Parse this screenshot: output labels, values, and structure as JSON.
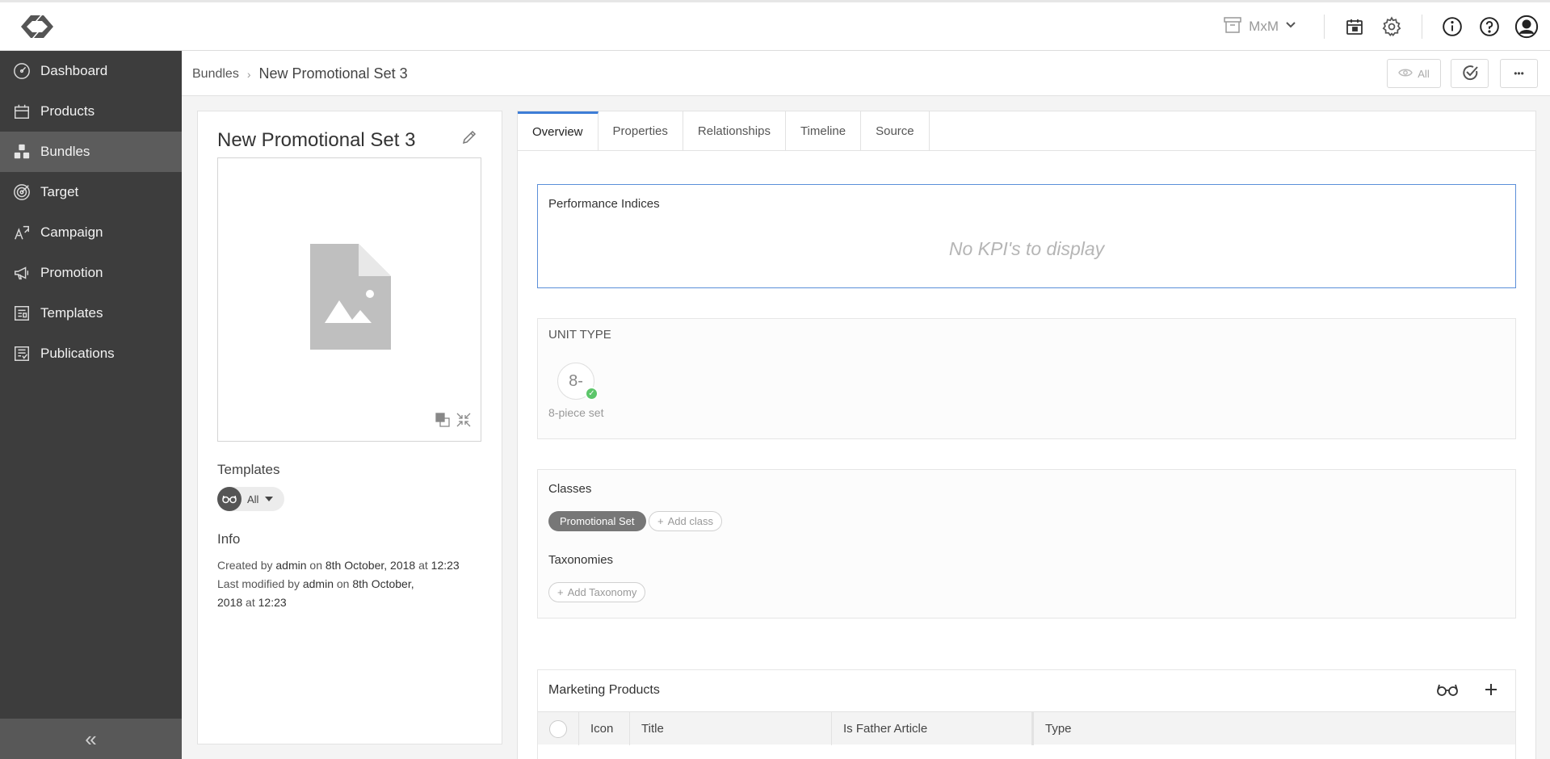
{
  "topbar": {
    "store_label": "MxM",
    "icons": [
      "logo-icon",
      "archive-icon",
      "chevron-down-icon",
      "calendar-box-icon",
      "gear-icon",
      "info-icon",
      "help-icon",
      "user-icon"
    ]
  },
  "sidebar": {
    "items": [
      {
        "label": "Dashboard",
        "icon": "dashboard-icon"
      },
      {
        "label": "Products",
        "icon": "products-icon"
      },
      {
        "label": "Bundles",
        "icon": "bundles-icon"
      },
      {
        "label": "Target",
        "icon": "target-icon"
      },
      {
        "label": "Campaign",
        "icon": "campaign-icon"
      },
      {
        "label": "Promotion",
        "icon": "megaphone-icon"
      },
      {
        "label": "Templates",
        "icon": "templates-icon"
      },
      {
        "label": "Publications",
        "icon": "publications-icon"
      }
    ],
    "active_index": 2,
    "collapse_label": "«"
  },
  "breadcrumb": {
    "parent": "Bundles",
    "separator": "›",
    "current": "New Promotional Set 3",
    "view_all_label": "All",
    "more_label": "•••"
  },
  "leftcard": {
    "title": "New Promotional Set 3",
    "templates_heading": "Templates",
    "templates_filter": "All",
    "info_heading": "Info",
    "created_prefix": "Created by",
    "created_user": "admin",
    "created_on": "on",
    "created_date": "8th October, 2018",
    "created_at": "at",
    "created_time": "12:23",
    "modified_prefix": "Last modified by",
    "modified_user": "admin",
    "modified_on": "on",
    "modified_date": "8th October, 2018",
    "modified_at": "at",
    "modified_time": "12:23"
  },
  "tabs": [
    "Overview",
    "Properties",
    "Relationships",
    "Timeline",
    "Source"
  ],
  "active_tab": 0,
  "kpi": {
    "title": "Performance Indices",
    "empty": "No KPI's to display"
  },
  "unit_type": {
    "title": "UNIT TYPE",
    "badge": "8-",
    "label": "8-piece set"
  },
  "classes": {
    "title": "Classes",
    "items": [
      "Promotional Set"
    ],
    "add_label": "Add class",
    "taxonomies_title": "Taxonomies",
    "add_taxonomy_label": "Add Taxonomy"
  },
  "marketing_products": {
    "title": "Marketing Products",
    "columns": [
      "Icon",
      "Title",
      "Is Father Article",
      "Type"
    ]
  },
  "colors": {
    "sidebar_bg": "#3d3d3d",
    "sidebar_active": "#5c5c5c",
    "accent": "#3d7dd6",
    "success": "#5cc66a"
  }
}
